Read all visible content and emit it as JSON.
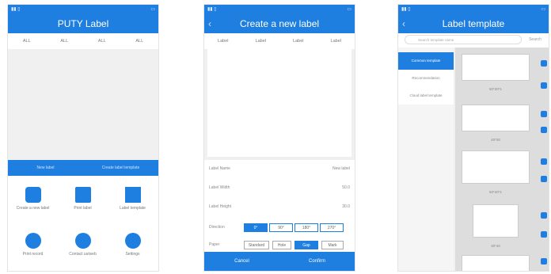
{
  "screen1": {
    "title": "PUTY Label",
    "tabs": [
      "ALL",
      "ALL",
      "ALL",
      "ALL"
    ],
    "blue_bar": [
      "New label",
      "Create label template"
    ],
    "grid": [
      {
        "label": "Create a new label",
        "icon": "cloud-tag-icon"
      },
      {
        "label": "Print label",
        "icon": "printer-icon"
      },
      {
        "label": "Label template",
        "icon": "template-grid-icon"
      },
      {
        "label": "Print record",
        "icon": "clock-icon"
      },
      {
        "label": "Contact us/web",
        "icon": "globe-icon"
      },
      {
        "label": "Settings",
        "icon": "gear-icon"
      }
    ]
  },
  "screen2": {
    "title": "Create a new label",
    "tabs": [
      "Label",
      "Label",
      "Label",
      "Label"
    ],
    "fields": [
      {
        "label": "Label Name",
        "value": "New label"
      },
      {
        "label": "Label Width",
        "value": "50.0"
      },
      {
        "label": "Label Height",
        "value": "30.0"
      }
    ],
    "direction_label": "Direction",
    "directions": [
      "0°",
      "90°",
      "180°",
      "270°"
    ],
    "paper_label": "Paper",
    "paper_options": [
      "Standard",
      "Hole",
      "Gap",
      "Mark"
    ],
    "cancel": "Cancel",
    "confirm": "Confirm"
  },
  "screen3": {
    "title": "Label template",
    "search_placeholder": "Search template name",
    "search_button": "Search",
    "sidebar": [
      "Common template",
      "Recommendation",
      "Cloud label template"
    ],
    "captions": [
      "50*30*1",
      "40*30",
      "50*40*1",
      "30*40"
    ]
  }
}
